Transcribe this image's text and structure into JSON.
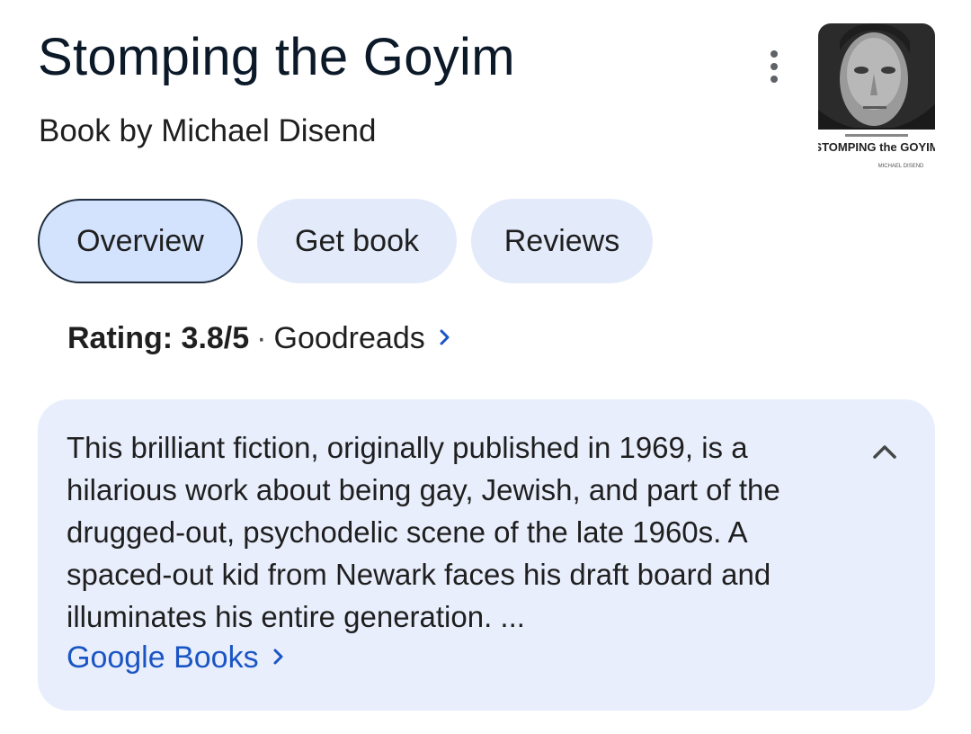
{
  "header": {
    "title": "Stomping the Goyim",
    "subtitle": "Book by Michael Disend",
    "more_options_icon": "more-vert-icon"
  },
  "cover": {
    "title_text": "STOMPING the GOYIM",
    "author_text": "MICHAEL DISEND"
  },
  "tabs": [
    {
      "label": "Overview",
      "selected": true
    },
    {
      "label": "Get book",
      "selected": false
    },
    {
      "label": "Reviews",
      "selected": false
    }
  ],
  "rating": {
    "label": "Rating: 3.8/5",
    "separator": "·",
    "source": "Goodreads",
    "icon": "chevron-right-icon"
  },
  "description": {
    "text": "This brilliant fiction, originally published in 1969, is a hilarious work about being gay, Jewish, and part of the drugged-out, psychodelic scene of the late 1960s. A spaced-out kid from Newark faces his draft board and illuminates his entire generation. ...",
    "collapse_icon": "chevron-up-icon",
    "source_link": "Google Books",
    "source_icon": "chevron-right-icon"
  },
  "colors": {
    "tab_bg": "#e3ebfb",
    "tab_selected_bg": "#d3e3fd",
    "card_bg": "#e8eefc",
    "link": "#1a55c4"
  }
}
